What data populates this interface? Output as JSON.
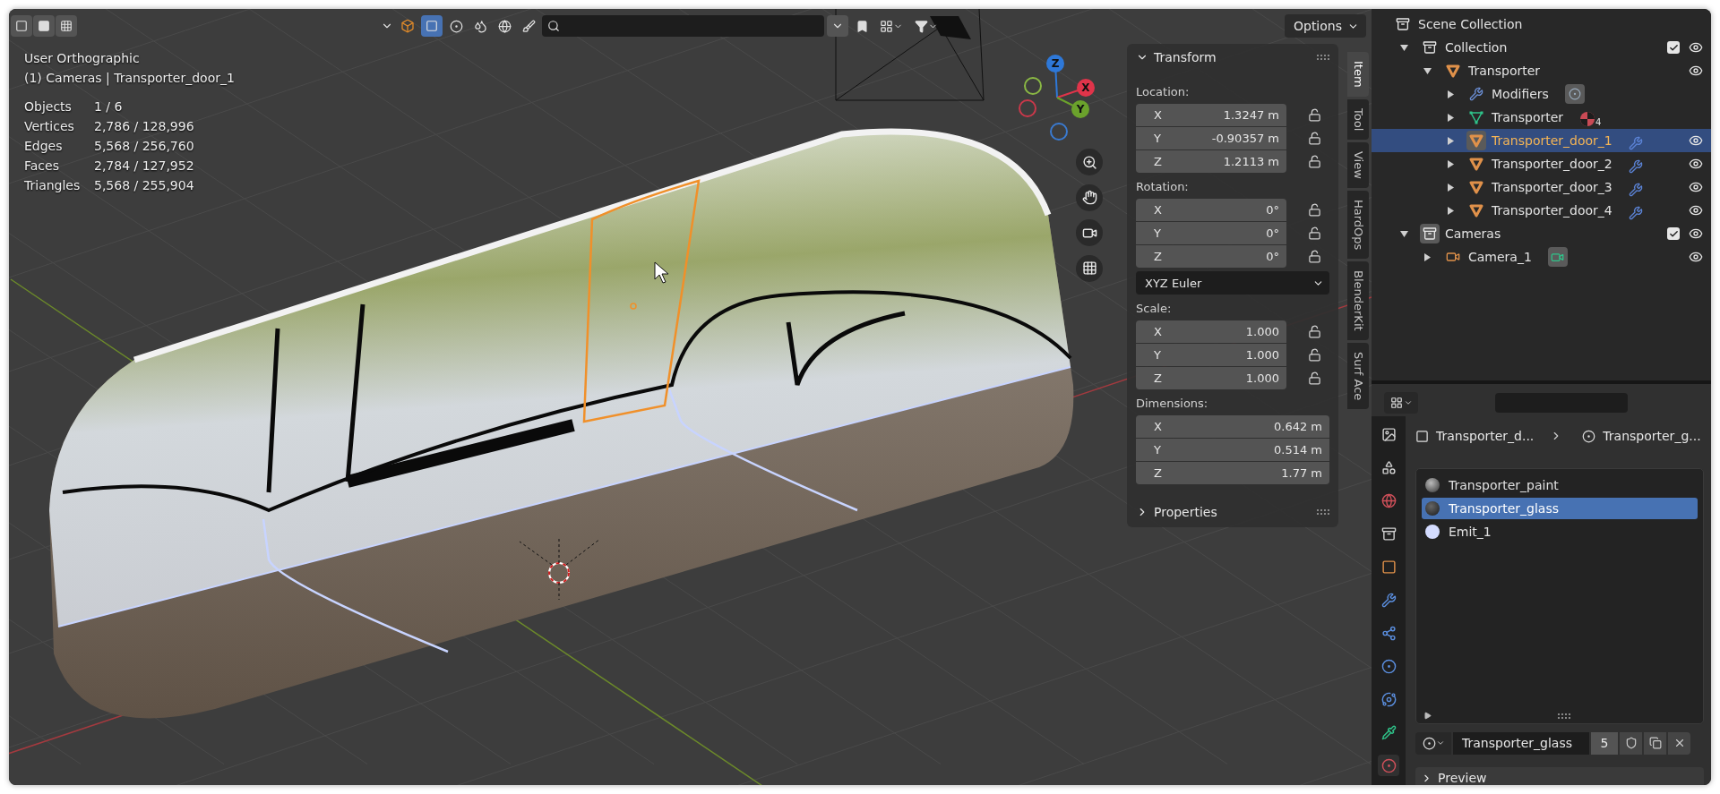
{
  "viewport": {
    "options_label": "Options",
    "view_name": "User Orthographic",
    "context": "(1) Cameras | Transporter_door_1",
    "stats": [
      {
        "label": "Objects",
        "value": "1 / 6"
      },
      {
        "label": "Vertices",
        "value": "2,786 / 128,996"
      },
      {
        "label": "Edges",
        "value": "5,568 / 256,760"
      },
      {
        "label": "Faces",
        "value": "2,784 / 127,952"
      },
      {
        "label": "Triangles",
        "value": "5,568 / 255,904"
      }
    ],
    "gizmo": [
      {
        "label": "Z",
        "kind": "positive",
        "color": "#2e78d8"
      },
      {
        "label": "X",
        "kind": "positive",
        "color": "#e0344a"
      },
      {
        "label": "Y",
        "kind": "positive",
        "color": "#6ba22c"
      },
      {
        "kind": "negative",
        "color": "#8ab844"
      },
      {
        "kind": "negative",
        "color": "#c9384a"
      },
      {
        "kind": "negative",
        "color": "#3a7ad0"
      }
    ]
  },
  "sidebar_tabs": [
    {
      "label": "Item",
      "selected": true
    },
    {
      "label": "Tool",
      "selected": false
    },
    {
      "label": "View",
      "selected": false
    },
    {
      "label": "HardOps",
      "selected": false
    },
    {
      "label": "BlenderKit",
      "selected": false
    },
    {
      "label": "Surf Ace",
      "selected": false
    }
  ],
  "transform": {
    "title": "Transform",
    "expanded": true,
    "groups": [
      {
        "label": "Location:",
        "fields": [
          {
            "axis": "X",
            "value": "1.3247 m",
            "locked": false
          },
          {
            "axis": "Y",
            "value": "-0.90357 m",
            "locked": false
          },
          {
            "axis": "Z",
            "value": "1.2113 m",
            "locked": false
          }
        ]
      },
      {
        "label": "Rotation:",
        "fields": [
          {
            "axis": "X",
            "value": "0°",
            "locked": false
          },
          {
            "axis": "Y",
            "value": "0°",
            "locked": false
          },
          {
            "axis": "Z",
            "value": "0°",
            "locked": false
          }
        ],
        "mode": "XYZ Euler"
      },
      {
        "label": "Scale:",
        "fields": [
          {
            "axis": "X",
            "value": "1.000",
            "locked": false
          },
          {
            "axis": "Y",
            "value": "1.000",
            "locked": false
          },
          {
            "axis": "Z",
            "value": "1.000",
            "locked": false
          }
        ]
      },
      {
        "label": "Dimensions:",
        "fields": [
          {
            "axis": "X",
            "value": "0.642 m"
          },
          {
            "axis": "Y",
            "value": "0.514 m"
          },
          {
            "axis": "Z",
            "value": "1.77 m"
          }
        ]
      }
    ]
  },
  "properties_panel": {
    "title": "Properties",
    "expanded": false
  },
  "outliner": {
    "root": "Scene Collection",
    "items": [
      {
        "kind": "collection",
        "label": "Collection",
        "expanded": true,
        "checked": true,
        "visible": true,
        "selected": false,
        "active": false,
        "children": [
          {
            "kind": "object",
            "label": "Transporter",
            "expanded": true,
            "visible": true,
            "selected": false,
            "children": [
              {
                "kind": "modifiers",
                "label": "Modifiers",
                "expanded": false,
                "badge": {
                  "kind": "modifier"
                },
                "selected": false
              },
              {
                "kind": "mesh",
                "label": "Transporter",
                "expanded": false,
                "badge": {
                  "kind": "material",
                  "count": "4"
                },
                "selected": false
              },
              {
                "kind": "object",
                "label": "Transporter_door_1",
                "expanded": false,
                "badge": {
                  "kind": "wrench"
                },
                "visible": true,
                "selected": true
              },
              {
                "kind": "object",
                "label": "Transporter_door_2",
                "expanded": false,
                "badge": {
                  "kind": "wrench"
                },
                "visible": true,
                "selected": false
              },
              {
                "kind": "object",
                "label": "Transporter_door_3",
                "expanded": false,
                "badge": {
                  "kind": "wrench"
                },
                "visible": true,
                "selected": false
              },
              {
                "kind": "object",
                "label": "Transporter_door_4",
                "expanded": false,
                "badge": {
                  "kind": "wrench"
                },
                "visible": true,
                "selected": false
              }
            ]
          }
        ]
      },
      {
        "kind": "collection",
        "label": "Cameras",
        "expanded": true,
        "checked": true,
        "visible": true,
        "selected": false,
        "active": true,
        "children": [
          {
            "kind": "camera",
            "label": "Camera_1",
            "expanded": false,
            "badge": {
              "kind": "camera"
            },
            "visible": true,
            "selected": false
          }
        ]
      }
    ]
  },
  "properties": {
    "breadcrumb": [
      "Transporter_d...",
      "Transporter_g..."
    ],
    "materials": [
      {
        "name": "Transporter_paint",
        "kind": "paint",
        "selected": false
      },
      {
        "name": "Transporter_glass",
        "kind": "glass",
        "selected": true
      },
      {
        "name": "Emit_1",
        "kind": "emit",
        "selected": false
      }
    ],
    "slot": {
      "name": "Transporter_glass",
      "users": "5"
    },
    "preview": {
      "title": "Preview",
      "expanded": false
    }
  }
}
